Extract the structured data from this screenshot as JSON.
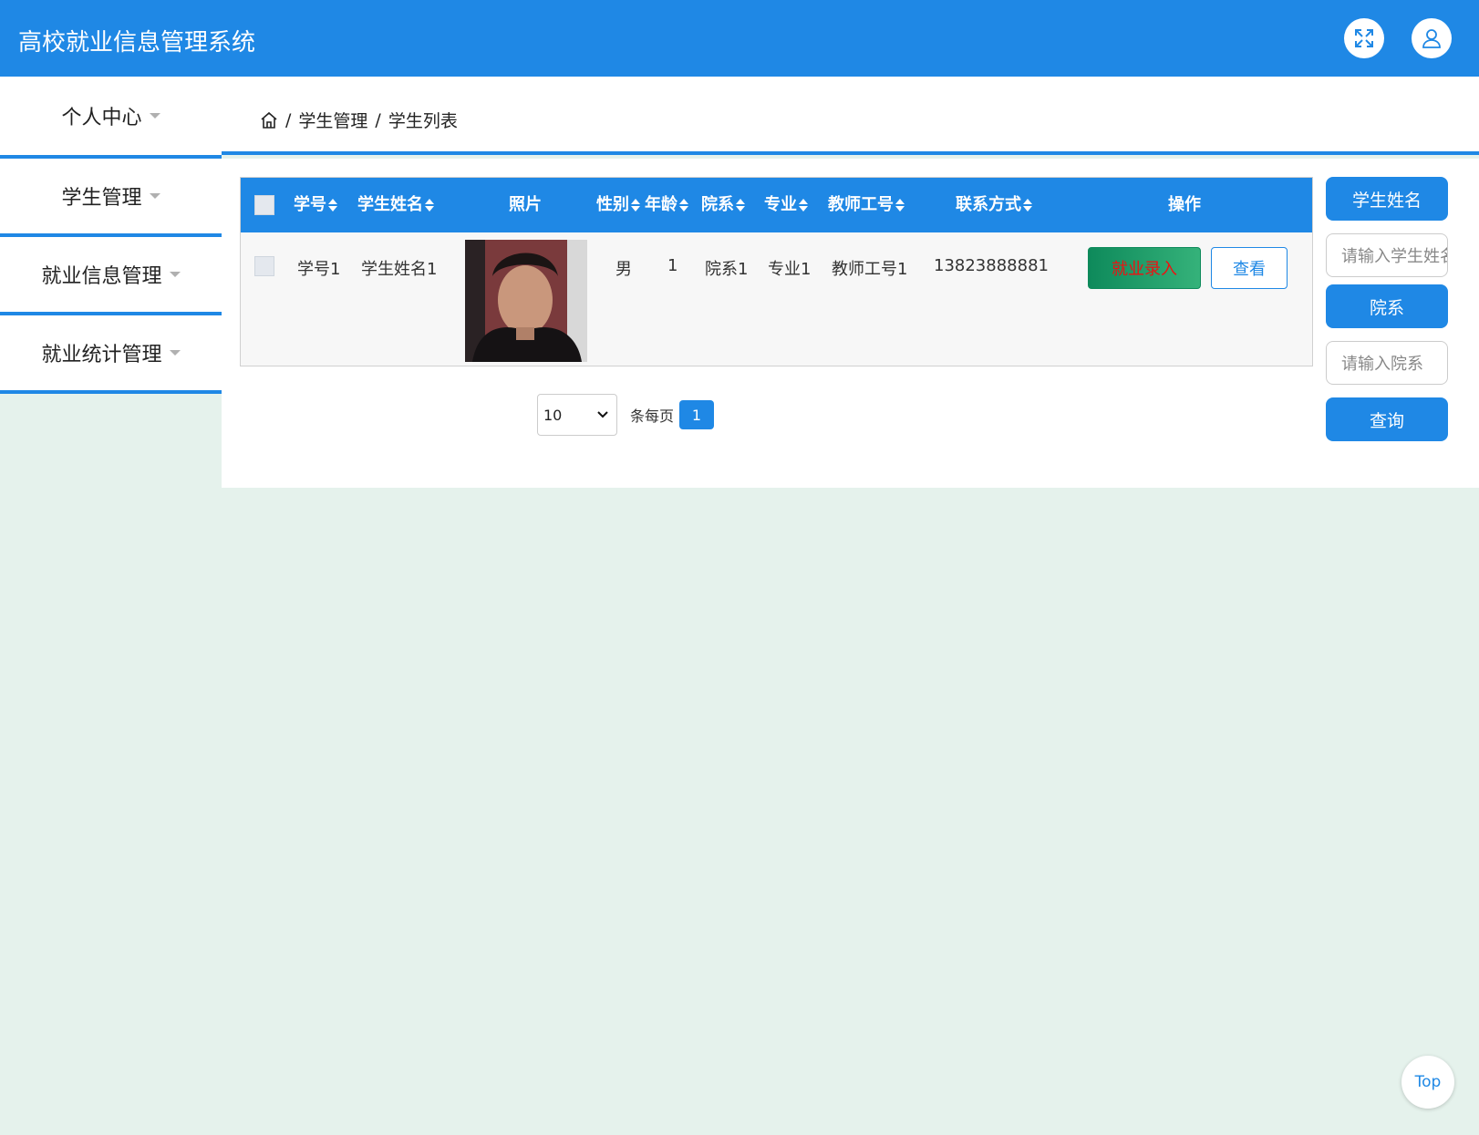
{
  "header": {
    "title": "高校就业信息管理系统",
    "fullscreen_icon": "expand-icon",
    "user_icon": "user-icon"
  },
  "sidebar": {
    "items": [
      {
        "label": "个人中心"
      },
      {
        "label": "学生管理"
      },
      {
        "label": "就业信息管理"
      },
      {
        "label": "就业统计管理"
      }
    ]
  },
  "breadcrumb": {
    "home_icon": "home-icon",
    "sep": "/",
    "level1": "学生管理",
    "level2": "学生列表"
  },
  "table": {
    "columns": [
      "学号",
      "学生姓名",
      "照片",
      "性别",
      "年龄",
      "院系",
      "专业",
      "教师工号",
      "联系方式",
      "操作"
    ],
    "rows": [
      {
        "student_id": "学号1",
        "name": "学生姓名1",
        "gender": "男",
        "age": "1",
        "department": "院系1",
        "major": "专业1",
        "teacher_id": "教师工号1",
        "phone": "13823888881",
        "employ_btn": "就业录入",
        "view_btn": "查看"
      }
    ]
  },
  "pager": {
    "page_size": "10",
    "per_page_text": "条每页",
    "current_page": "1"
  },
  "search": {
    "name_label": "学生姓名",
    "name_placeholder": "请输入学生姓名",
    "dept_label": "院系",
    "dept_placeholder": "请输入院系",
    "query_btn": "查询"
  },
  "back_to_top": "Top",
  "colors": {
    "primary": "#1f88e5",
    "background": "#e5f2ec",
    "employ_btn_start": "#0e8a5b",
    "employ_btn_end": "#35b27a",
    "employ_text": "#ee1111"
  }
}
